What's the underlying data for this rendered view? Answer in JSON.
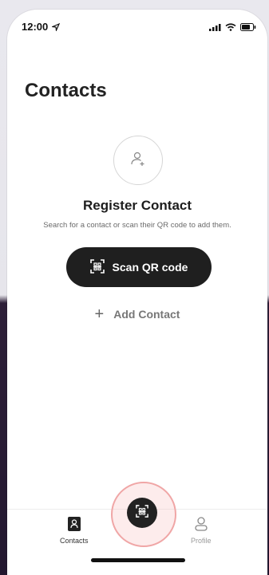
{
  "status_bar": {
    "time": "12:00"
  },
  "header": {
    "title": "Contacts"
  },
  "empty_state": {
    "title": "Register Contact",
    "subtitle": "Search for a contact or scan their QR code to add them."
  },
  "actions": {
    "scan_label": "Scan QR code",
    "add_label": "Add Contact"
  },
  "tab_bar": {
    "contacts_label": "Contacts",
    "profile_label": "Profile"
  },
  "colors": {
    "primary_dark": "#1f1f1f",
    "fab_ring": "#f0a6a6"
  }
}
